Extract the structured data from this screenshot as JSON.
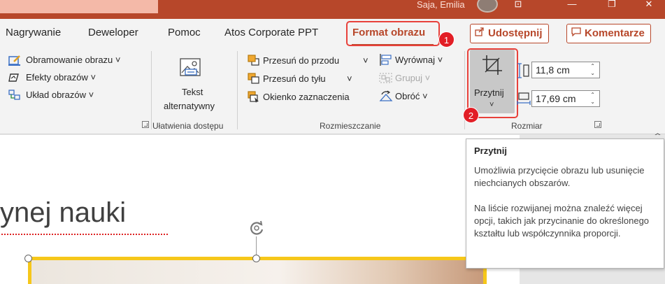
{
  "titlebar": {
    "user_name": "Saja, Emilia",
    "buttons": {
      "ribbon_display": "⊡",
      "minimize": "—",
      "restore": "❐",
      "close": "✕"
    }
  },
  "tabs": [
    {
      "label": "Nagrywanie"
    },
    {
      "label": "Deweloper"
    },
    {
      "label": "Pomoc"
    },
    {
      "label": "Atos Corporate PPT"
    },
    {
      "label": "Format obrazu",
      "active": true
    }
  ],
  "share": {
    "label": "Udostępnij",
    "icon": "share-icon"
  },
  "comments": {
    "label": "Komentarze",
    "icon": "comment-icon"
  },
  "callouts": {
    "first": "1",
    "second": "2"
  },
  "ribbon": {
    "picture_styles": {
      "border": "Obramowanie obrazu ˅",
      "effects": "Efekty obrazów ˅",
      "layout": "Układ obrazów ˅"
    },
    "accessibility": {
      "alt_text_line1": "Tekst",
      "alt_text_line2": "alternatywny",
      "group_label": "Ułatwienia dostępu"
    },
    "arrange": {
      "bring_forward": "Przesuń do przodu",
      "bring_forward_arrow": "˅",
      "send_backward": "Przesuń do tyłu",
      "send_backward_arrow": "˅",
      "selection_pane": "Okienko zaznaczenia",
      "align": "Wyrównaj ˅",
      "group": "Grupuj ˅",
      "rotate": "Obróć ˅",
      "group_label": "Rozmieszczanie"
    },
    "size": {
      "crop_label": "Przytnij",
      "crop_arrow": "˅",
      "height_value": "11,8  cm",
      "width_value": "17,69  cm",
      "group_label": "Rozmiar"
    }
  },
  "slide": {
    "title_fragment": "ynej nauki"
  },
  "tooltip": {
    "title": "Przytnij",
    "para1": "Umożliwia przycięcie obrazu lub usunięcie niechcianych obszarów.",
    "para2": "Na liście rozwijanej można znaleźć więcej opcji, takich jak przycinanie do określonego kształtu lub współczynnika proporcji."
  },
  "colors": {
    "accent": "#b7472a",
    "callout_red": "#e8413b",
    "selection_yellow": "#f6c71a"
  }
}
